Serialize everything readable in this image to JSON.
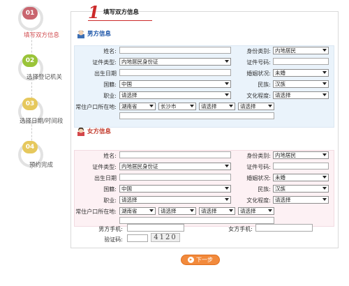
{
  "steps": [
    {
      "num": "01",
      "label": "填写双方信息"
    },
    {
      "num": "02",
      "label": "选择登记机关"
    },
    {
      "num": "03",
      "label": "选择日期/时间段"
    },
    {
      "num": "04",
      "label": "预约完成"
    }
  ],
  "header": {
    "number": "1",
    "title": "填写双方信息"
  },
  "male": {
    "title": "男方信息",
    "name_label": "姓名:",
    "identity_label": "身份类别:",
    "identity_value": "内地居民",
    "cert_type_label": "证件类型:",
    "cert_type_value": "内地居民身份证",
    "cert_no_label": "证件号码:",
    "birth_label": "出生日期",
    "marital_label": "婚姻状况:",
    "marital_value": "未婚",
    "nationality_label": "国籍:",
    "nationality_value": "中国",
    "ethnic_label": "民族:",
    "ethnic_value": "汉族",
    "job_label": "职业:",
    "job_value": "请选择",
    "edu_label": "文化程度:",
    "edu_value": "请选择",
    "hukou_label": "常住户口所在地:",
    "province": "湖南省",
    "city": "长沙市",
    "district": "请选择",
    "town": "请选择"
  },
  "female": {
    "title": "女方信息",
    "name_label": "姓名:",
    "identity_label": "身份类别:",
    "identity_value": "内地居民",
    "cert_type_label": "证件类型:",
    "cert_type_value": "内地居民身份证",
    "cert_no_label": "证件号码:",
    "birth_label": "出生日期",
    "marital_label": "婚姻状况:",
    "marital_value": "未婚",
    "nationality_label": "国籍:",
    "nationality_value": "中国",
    "ethnic_label": "民族:",
    "ethnic_value": "汉族",
    "job_label": "职业:",
    "job_value": "请选择",
    "edu_label": "文化程度:",
    "edu_value": "请选择",
    "hukou_label": "常住户口所在地:",
    "province": "湖南省",
    "city": "请选择",
    "district": "请选择",
    "town": "请选择"
  },
  "contact": {
    "male_phone_label": "男方手机:",
    "female_phone_label": "女方手机:",
    "captcha_label": "验证码:",
    "captcha_code": "4120"
  },
  "next_button": "下一步"
}
